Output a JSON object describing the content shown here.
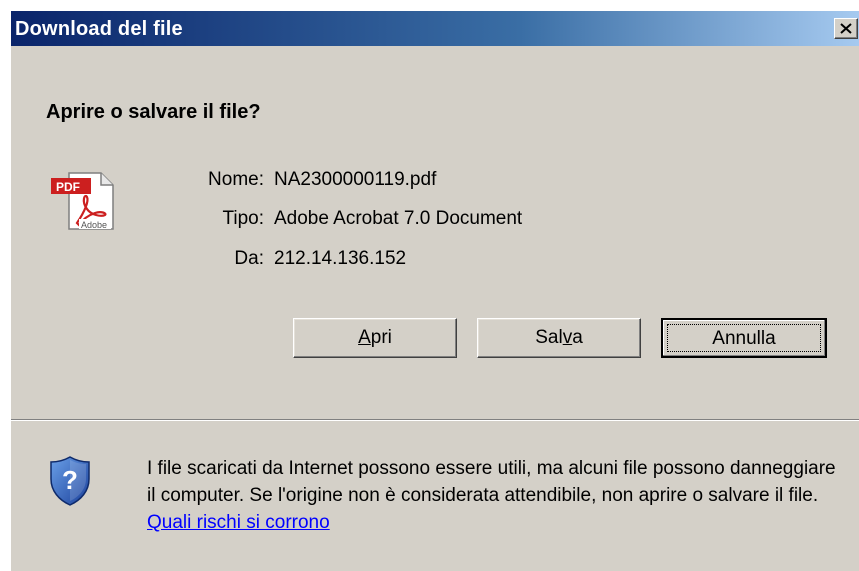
{
  "window": {
    "title": "Download del file",
    "close_label": "Chiudi"
  },
  "dialog": {
    "heading": "Aprire o salvare il file?",
    "icon": "pdf-document-icon",
    "file": {
      "name_label": "Nome:",
      "name_value": "NA2300000119.pdf",
      "type_label": "Tipo:",
      "type_value": "Adobe Acrobat 7.0 Document",
      "from_label": "Da:",
      "from_value": "212.14.136.152"
    },
    "buttons": {
      "open": {
        "pre": "",
        "accel": "A",
        "post": "pri"
      },
      "save": {
        "pre": "Sal",
        "accel": "v",
        "post": "a"
      },
      "cancel": {
        "label": "Annulla"
      }
    }
  },
  "warning": {
    "icon": "shield-question-icon",
    "text": "I file scaricati da Internet possono essere utili, ma alcuni file possono danneggiare il computer. Se l'origine non è considerata attendibile, non aprire o salvare il file. ",
    "link": "Quali rischi si corrono"
  },
  "colors": {
    "dialog_bg": "#d4d0c8",
    "title_start": "#0a246a",
    "title_end": "#a6caf0",
    "link": "#0000ff"
  }
}
